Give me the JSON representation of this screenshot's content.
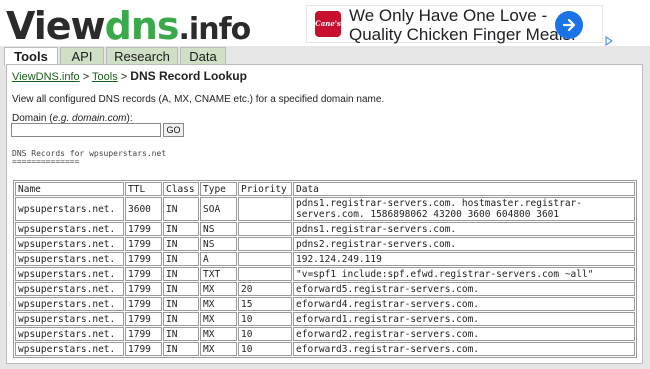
{
  "logo": {
    "part1": "View",
    "part2": "dns",
    "part3": ".info"
  },
  "ad": {
    "brand_mark": "Cane's",
    "line1": "We Only Have One Love -",
    "line2": "Quality Chicken Finger Meals.",
    "close": "✕"
  },
  "tabs": [
    {
      "label": "Tools",
      "active": true
    },
    {
      "label": "API",
      "active": false
    },
    {
      "label": "Research",
      "active": false
    },
    {
      "label": "Data",
      "active": false
    }
  ],
  "breadcrumb": {
    "home": "ViewDNS.info",
    "sep1": ">",
    "tools": "Tools",
    "sep2": ">",
    "current": "DNS Record Lookup"
  },
  "description": "View all configured DNS records (A, MX, CNAME etc.) for a specified domain name.",
  "form": {
    "label_prefix": "Domain (",
    "label_example": "e.g. domain.com",
    "label_suffix": "):",
    "input_value": "",
    "go_label": "GO"
  },
  "records_heading": "DNS Records for wpsuperstars.net",
  "records_underline": "==============",
  "table": {
    "headers": [
      "Name",
      "TTL",
      "Class",
      "Type",
      "Priority",
      "Data"
    ],
    "rows": [
      [
        "wpsuperstars.net.",
        "3600",
        "IN",
        "SOA",
        "",
        "pdns1.registrar-servers.com. hostmaster.registrar-servers.com. 1586898062 43200 3600 604800 3601"
      ],
      [
        "wpsuperstars.net.",
        "1799",
        "IN",
        "NS",
        "",
        "pdns1.registrar-servers.com."
      ],
      [
        "wpsuperstars.net.",
        "1799",
        "IN",
        "NS",
        "",
        "pdns2.registrar-servers.com."
      ],
      [
        "wpsuperstars.net.",
        "1799",
        "IN",
        "A",
        "",
        "192.124.249.119"
      ],
      [
        "wpsuperstars.net.",
        "1799",
        "IN",
        "TXT",
        "",
        "\"v=spf1 include:spf.efwd.registrar-servers.com ~all\""
      ],
      [
        "wpsuperstars.net.",
        "1799",
        "IN",
        "MX",
        "20",
        "eforward5.registrar-servers.com."
      ],
      [
        "wpsuperstars.net.",
        "1799",
        "IN",
        "MX",
        "15",
        "eforward4.registrar-servers.com."
      ],
      [
        "wpsuperstars.net.",
        "1799",
        "IN",
        "MX",
        "10",
        "eforward1.registrar-servers.com."
      ],
      [
        "wpsuperstars.net.",
        "1799",
        "IN",
        "MX",
        "10",
        "eforward2.registrar-servers.com."
      ],
      [
        "wpsuperstars.net.",
        "1799",
        "IN",
        "MX",
        "10",
        "eforward3.registrar-servers.com."
      ]
    ]
  },
  "colors": {
    "brand_green": "#39a94a",
    "tab_bg": "#cfe0c7",
    "page_bg": "#e6e6e6",
    "ad_arrow": "#1a73e8"
  },
  "icons": {
    "ad_arrow": "arrow-right-icon",
    "ad_choices": "adchoices-icon"
  }
}
